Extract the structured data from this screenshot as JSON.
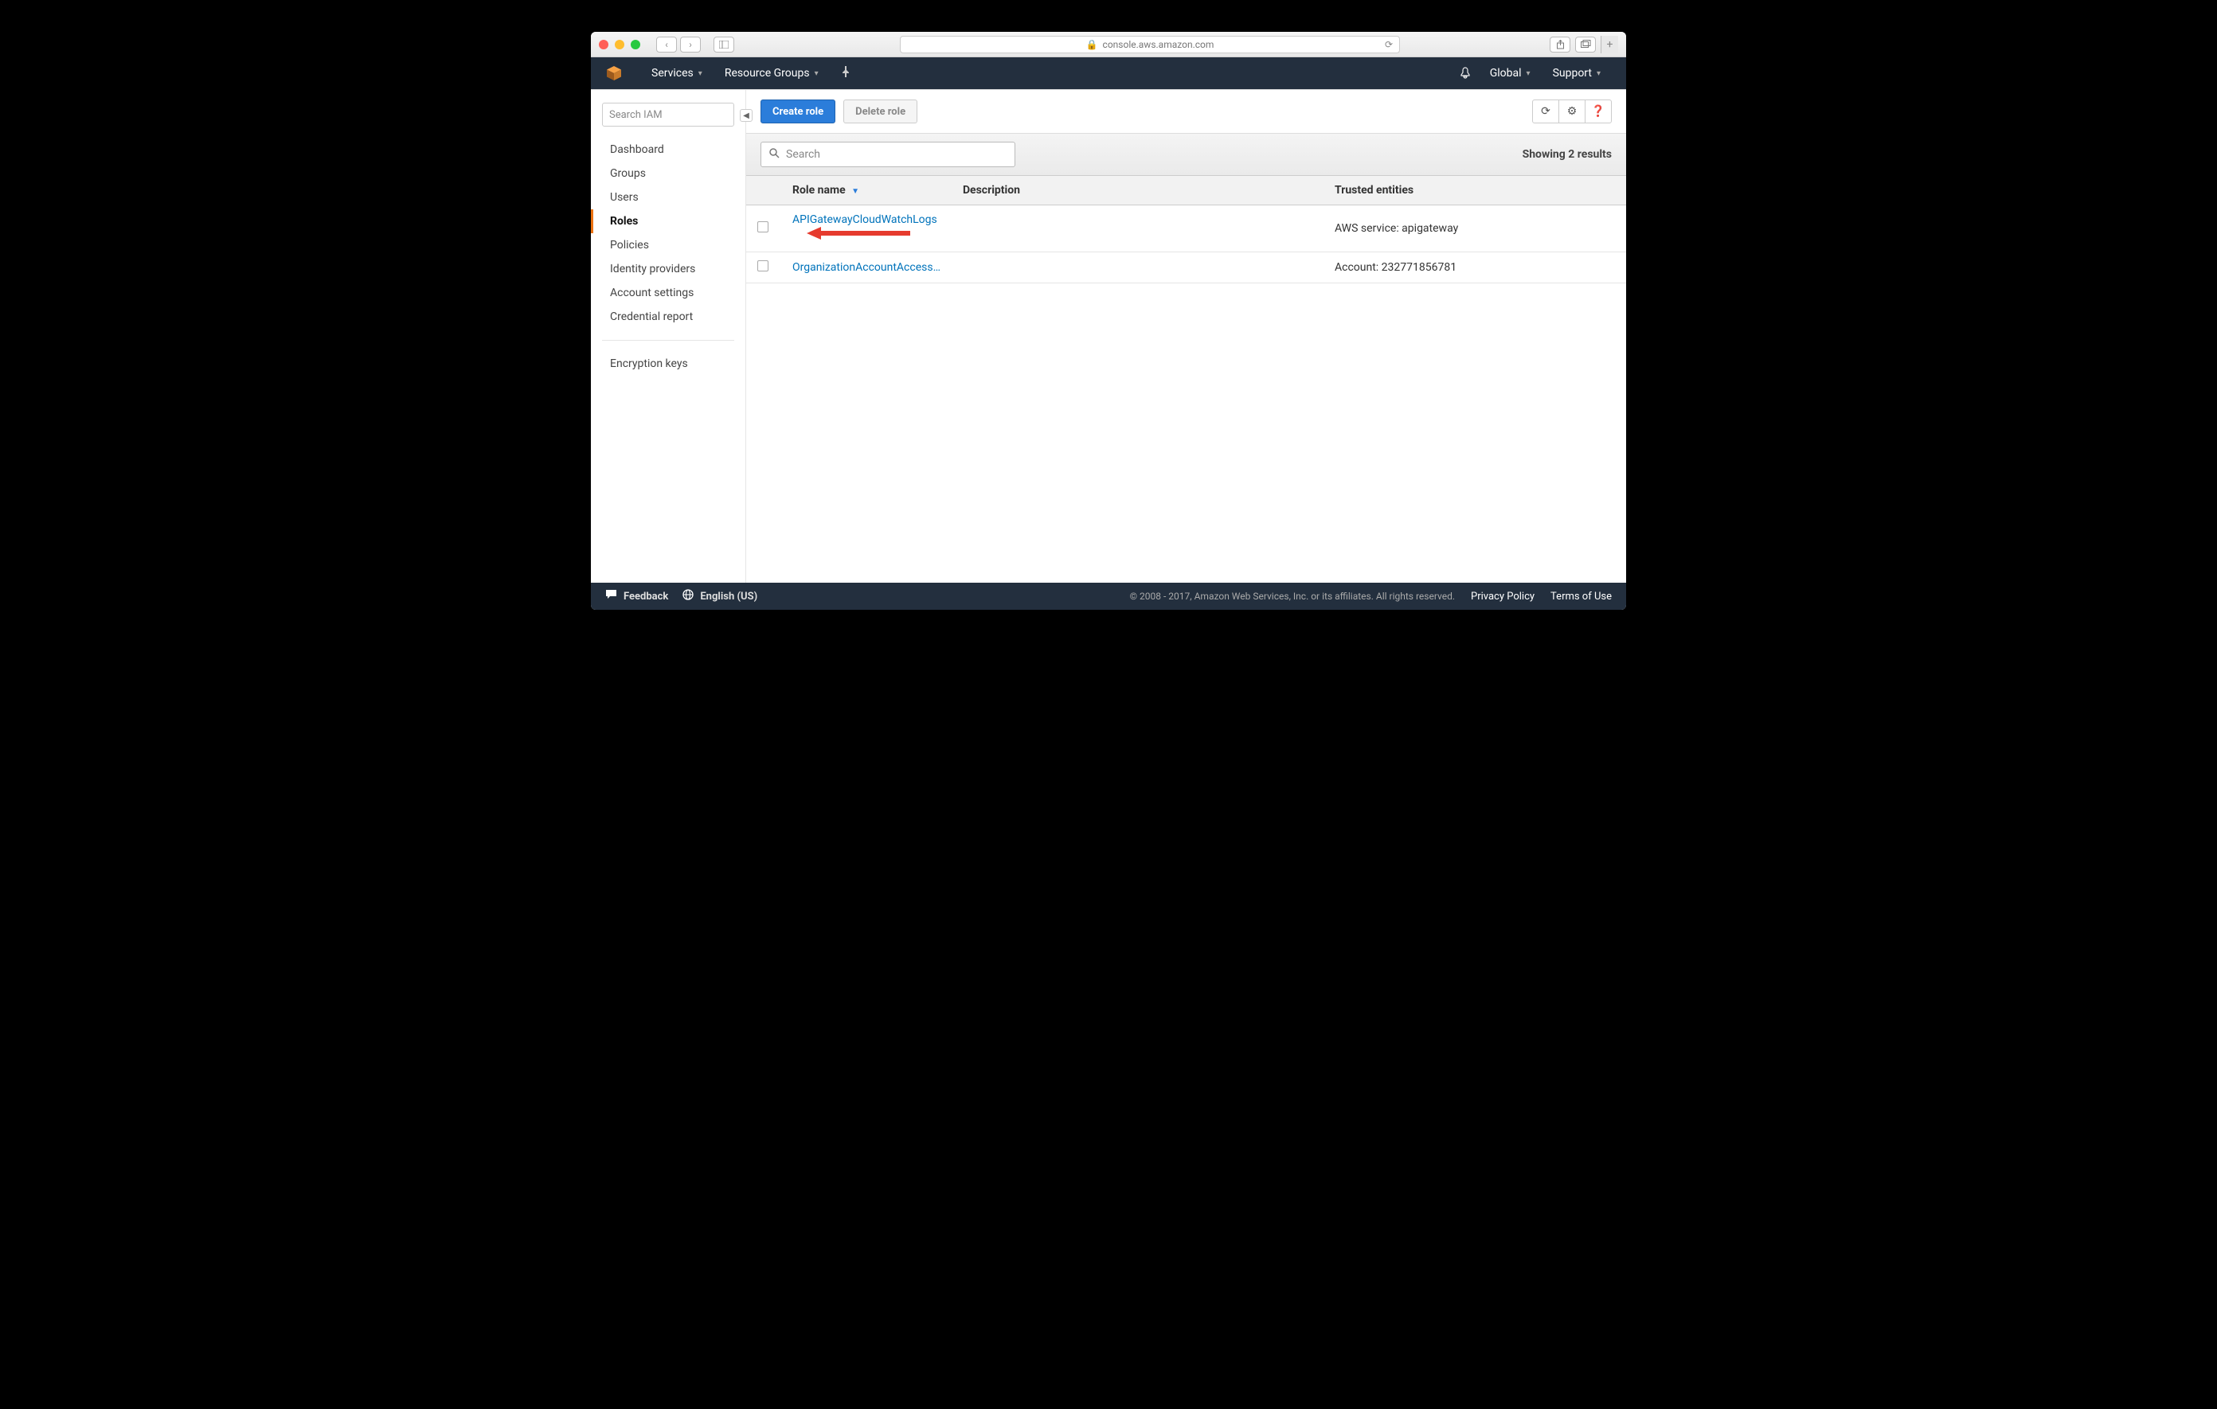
{
  "browser": {
    "url_host": "console.aws.amazon.com"
  },
  "header": {
    "menu_services": "Services",
    "menu_resource_groups": "Resource Groups",
    "region": "Global",
    "support": "Support"
  },
  "sidebar": {
    "search_placeholder": "Search IAM",
    "items": [
      {
        "label": "Dashboard"
      },
      {
        "label": "Groups"
      },
      {
        "label": "Users"
      },
      {
        "label": "Roles"
      },
      {
        "label": "Policies"
      },
      {
        "label": "Identity providers"
      },
      {
        "label": "Account settings"
      },
      {
        "label": "Credential report"
      }
    ],
    "extra": {
      "label": "Encryption keys"
    }
  },
  "toolbar": {
    "create_label": "Create role",
    "delete_label": "Delete role"
  },
  "searchrow": {
    "placeholder": "Search",
    "results_text": "Showing 2 results"
  },
  "table": {
    "columns": {
      "role_name": "Role name",
      "description": "Description",
      "trusted": "Trusted entities"
    },
    "rows": [
      {
        "role_name": "APIGatewayCloudWatchLogs",
        "description": "",
        "trusted": "AWS service: apigateway"
      },
      {
        "role_name": "OrganizationAccountAccess…",
        "description": "",
        "trusted": "Account: 232771856781"
      }
    ]
  },
  "footer": {
    "feedback": "Feedback",
    "language": "English (US)",
    "copyright": "© 2008 - 2017, Amazon Web Services, Inc. or its affiliates. All rights reserved.",
    "privacy": "Privacy Policy",
    "terms": "Terms of Use"
  }
}
